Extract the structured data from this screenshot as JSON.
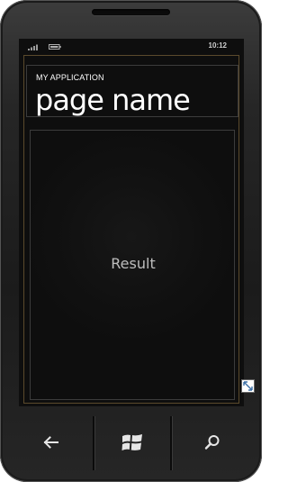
{
  "status_bar": {
    "signal_icon": "signal-strength-icon",
    "battery_icon": "battery-icon",
    "time": "10:12"
  },
  "title_panel": {
    "application_title": "MY APPLICATION",
    "page_title": "page name"
  },
  "content_panel": {
    "result_text": "Result"
  },
  "hardware_buttons": {
    "back_icon": "back-arrow-icon",
    "start_icon": "windows-start-icon",
    "search_icon": "search-icon"
  },
  "colors": {
    "screen_background": "#0e0e0e",
    "layout_border": "#5b4a2c",
    "panel_border": "#3c3c3c",
    "text": "#ffffff"
  }
}
